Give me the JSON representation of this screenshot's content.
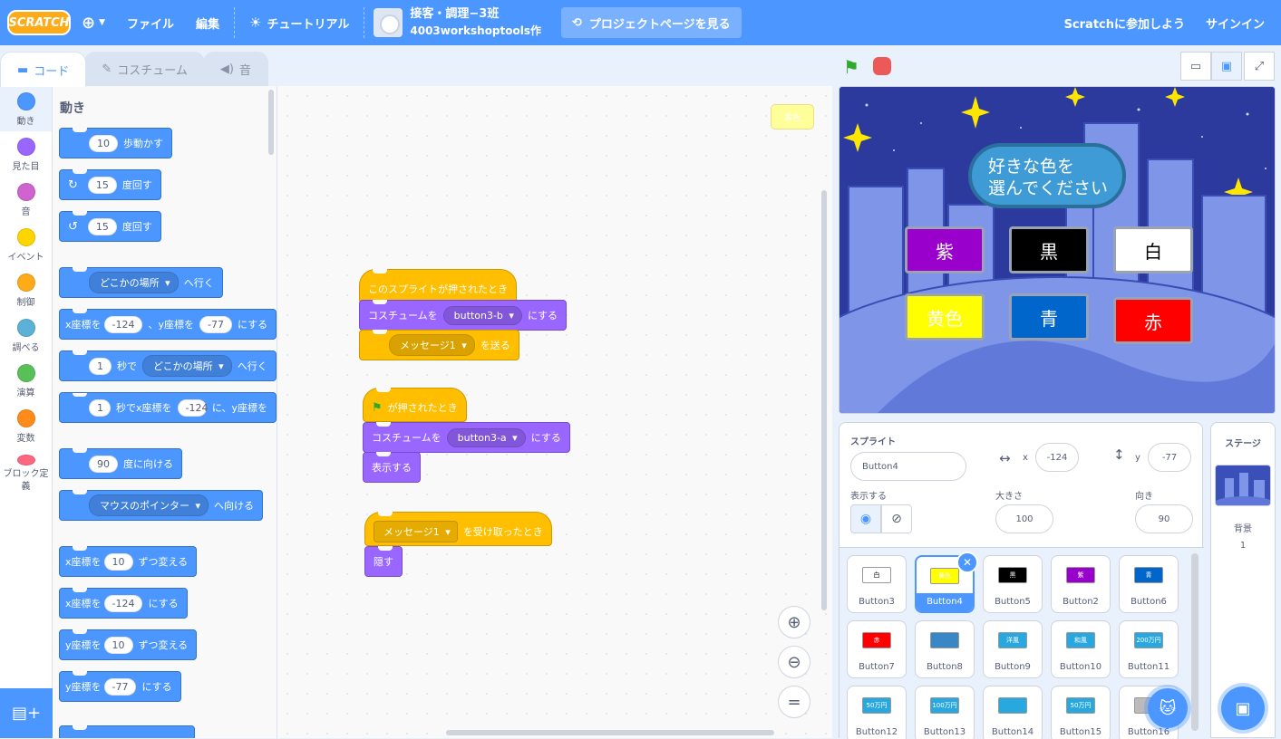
{
  "menu": {
    "logo": "SCRATCH",
    "file": "ファイル",
    "edit": "編集",
    "tutorials": "チュートリアル",
    "project_title": "接客・調理−3班",
    "project_author": "4003workshoptools作",
    "see_project_page": "プロジェクトページを見る",
    "join": "Scratchに参加しよう",
    "signin": "サインイン"
  },
  "tabs": {
    "code": "コード",
    "costumes": "コスチューム",
    "sounds": "音"
  },
  "categories": [
    {
      "label": "動き",
      "color": "#4c97ff"
    },
    {
      "label": "見た目",
      "color": "#9966ff"
    },
    {
      "label": "音",
      "color": "#cf63cf"
    },
    {
      "label": "イベント",
      "color": "#ffd500"
    },
    {
      "label": "制御",
      "color": "#ffab19"
    },
    {
      "label": "調べる",
      "color": "#5cb1d6"
    },
    {
      "label": "演算",
      "color": "#59c059"
    },
    {
      "label": "変数",
      "color": "#ff8c1a"
    },
    {
      "label": "ブロック定義",
      "color": "#ff6680"
    }
  ],
  "palette": {
    "heading": "動き",
    "move": {
      "val": "10",
      "text": "歩動かす"
    },
    "turn_right": {
      "val": "15",
      "text": "度回す"
    },
    "turn_left": {
      "val": "15",
      "text": "度回す"
    },
    "goto": {
      "dd": "どこかの場所",
      "text": "へ行く"
    },
    "gotoxy": {
      "t1": "x座標を",
      "x": "-124",
      "t2": "、y座標を",
      "y": "-77",
      "t3": "にする"
    },
    "glide": {
      "val": "1",
      "t1": "秒で",
      "dd": "どこかの場所",
      "t2": "へ行く"
    },
    "glidexy": {
      "val": "1",
      "t1": "秒でx座標を",
      "x": "-124",
      "t2": "に、y座標を"
    },
    "point": {
      "val": "90",
      "text": "度に向ける"
    },
    "pointto": {
      "dd": "マウスのポインター",
      "text": "へ向ける"
    },
    "changex": {
      "t1": "x座標を",
      "val": "10",
      "t2": "ずつ変える"
    },
    "setx": {
      "t1": "x座標を",
      "val": "-124",
      "t2": "にする"
    },
    "changey": {
      "t1": "y座標を",
      "val": "10",
      "t2": "ずつ変える"
    },
    "sety": {
      "t1": "y座標を",
      "val": "-77",
      "t2": "にする"
    }
  },
  "scripts": {
    "s1_hat": "このスプライトが押されたとき",
    "s1_costume": {
      "t1": "コスチュームを",
      "dd": "button3-b",
      "t2": "にする"
    },
    "s1_broadcast": {
      "dd": "メッセージ1",
      "t2": "を送る"
    },
    "s2_hat": "が押されたとき",
    "s2_costume": {
      "t1": "コスチュームを",
      "dd": "button3-a",
      "t2": "にする"
    },
    "s2_show": "表示する",
    "s3_hat": {
      "dd": "メッセージ1",
      "t2": "を受け取ったとき"
    },
    "s3_hide": "隠す",
    "ghost": "黄色"
  },
  "stage": {
    "bubble": [
      "好きな色を",
      "選んでください"
    ],
    "buttons": [
      {
        "label": "紫",
        "bg": "#9900cc",
        "fg": "#ffffff"
      },
      {
        "label": "黒",
        "bg": "#000000",
        "fg": "#ffffff"
      },
      {
        "label": "白",
        "bg": "#ffffff",
        "fg": "#000000"
      },
      {
        "label": "黄色",
        "bg": "#ffff00",
        "fg": "#ffffff"
      },
      {
        "label": "青",
        "bg": "#0066cc",
        "fg": "#ffffff"
      },
      {
        "label": "赤",
        "bg": "#ff0000",
        "fg": "#ffffff"
      }
    ]
  },
  "sprite_info": {
    "sprite_label": "スプライト",
    "name": "Button4",
    "x_label": "x",
    "x": "-124",
    "y_label": "y",
    "y": "-77",
    "show_label": "表示する",
    "size_label": "大きさ",
    "size": "100",
    "direction_label": "向き",
    "direction": "90"
  },
  "sprites": [
    {
      "name": "Button3",
      "label": "白",
      "bg": "#ffffff",
      "fg": "#000000"
    },
    {
      "name": "Button4",
      "label": "黄色",
      "bg": "#ffff00",
      "fg": "#ffffff",
      "selected": true
    },
    {
      "name": "Button5",
      "label": "黒",
      "bg": "#000000",
      "fg": "#ffffff"
    },
    {
      "name": "Button2",
      "label": "紫",
      "bg": "#9900cc",
      "fg": "#ffffff"
    },
    {
      "name": "Button6",
      "label": "青",
      "bg": "#0066cc",
      "fg": "#ffffff"
    },
    {
      "name": "Button7",
      "label": "赤",
      "bg": "#ff0000",
      "fg": "#ffffff"
    },
    {
      "name": "Button8",
      "label": "",
      "bg": "#3a87c8",
      "fg": "#ffffff"
    },
    {
      "name": "Button9",
      "label": "洋風",
      "bg": "#29a8e0",
      "fg": "#ffffff"
    },
    {
      "name": "Button10",
      "label": "和風",
      "bg": "#29a8e0",
      "fg": "#ffffff"
    },
    {
      "name": "Button11",
      "label": "200万円",
      "bg": "#29a8e0",
      "fg": "#ffffff"
    },
    {
      "name": "Button12",
      "label": "50万円",
      "bg": "#29a8e0",
      "fg": "#ffffff"
    },
    {
      "name": "Button13",
      "label": "100万円",
      "bg": "#29a8e0",
      "fg": "#ffffff"
    },
    {
      "name": "Button14",
      "label": "",
      "bg": "#29a8e0",
      "fg": "#ffffff"
    },
    {
      "name": "Button15",
      "label": "50万円",
      "bg": "#29a8e0",
      "fg": "#ffffff"
    },
    {
      "name": "Button16",
      "label": "",
      "bg": "#bbbbbb",
      "fg": "#ffffff"
    }
  ],
  "stage_pane": {
    "title": "ステージ",
    "backdrop_label": "背景",
    "backdrop_count": "1"
  }
}
